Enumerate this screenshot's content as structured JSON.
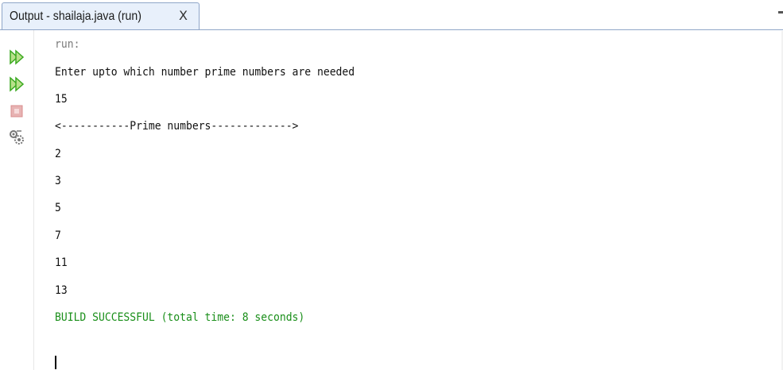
{
  "tab": {
    "title": "Output - shailaja.java (run)",
    "close_glyph": "X"
  },
  "toolbar": {
    "buttons": [
      {
        "name": "rerun-icon",
        "color": "#3aa81f"
      },
      {
        "name": "rerun-with-options-icon",
        "color": "#3aa81f"
      },
      {
        "name": "stop-icon",
        "color": "#d98c8c"
      },
      {
        "name": "settings-icon",
        "color": "#777777"
      }
    ]
  },
  "output": {
    "lines": [
      "run:",
      "Enter upto which number prime numbers are needed",
      "15",
      "<-----------Prime numbers------------->",
      "2",
      "3",
      "5",
      "7",
      "11",
      "13",
      "BUILD SUCCESSFUL (total time: 8 seconds)"
    ]
  },
  "colors": {
    "run_text": "#7a7a7a",
    "normal_text": "#111111",
    "success_text": "#1a8f1a",
    "tab_border": "#8fa6c8"
  }
}
